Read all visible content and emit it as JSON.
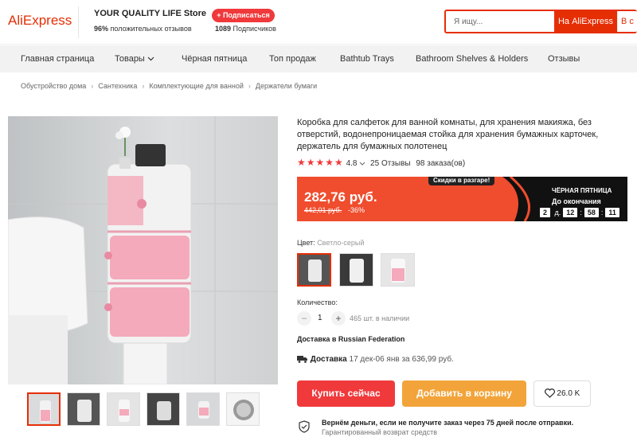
{
  "header": {
    "logo": "AliExpress",
    "store_name": "YOUR QUALITY LIFE Store",
    "caret": "›",
    "subscribe_label": "+ Подписаться",
    "positive_pct": "96%",
    "positive_label": "положительных отзывов",
    "subscribers_count": "1089",
    "subscribers_label": "Подписчиков",
    "search_placeholder": "Я ищу...",
    "search_button": "На AliExpress",
    "search_button2": "В с"
  },
  "nav": {
    "items": [
      "Главная страница",
      "Товары",
      "Чёрная пятница",
      "Топ продаж",
      "Bathtub Trays",
      "Bathroom Shelves & Holders",
      "Отзывы"
    ]
  },
  "breadcrumbs": [
    "Обустройство дома",
    "Сантехника",
    "Комплектующие для ванной",
    "Держатели бумаги"
  ],
  "product": {
    "title": "Коробка для салфеток для ванной комнаты, для хранения макияжа, без отверстий, водонепроницаемая стойка для хранения бумажных карточек, держатель для бумажных полотенец",
    "rating": "4.8",
    "reviews": "25 Отзывы",
    "orders": "98 заказа(ов)"
  },
  "promo": {
    "tag": "Скидки в разгаре!",
    "price": "282,76 руб.",
    "old_price": "442,01 руб.",
    "discount": "-36%",
    "black_friday": "ЧЁРНАЯ ПЯТНИЦА",
    "until_label": "До окончания",
    "days": "2",
    "days_unit": "д.",
    "hours": "12",
    "minutes": "58",
    "seconds": "11",
    "accent_color": "#ef4d2e"
  },
  "options": {
    "color_label": "Цвет:",
    "color_value": "Светло-серый",
    "quantity_label": "Количество:",
    "quantity": "1",
    "minus": "−",
    "plus": "+",
    "stock": "465 шт. в наличии"
  },
  "delivery": {
    "to": "Доставка в Russian Federation",
    "label": "Доставка",
    "details": "17 дек-06 янв за 636,99 руб."
  },
  "actions": {
    "buy": "Купить сейчас",
    "cart": "Добавить в корзину",
    "wishlist_count": "26.0 K"
  },
  "guarantee": {
    "line1": "Вернём деньги, если не получите заказ через 75 дней после отправки.",
    "line2": "Гарантированный возврат средств"
  }
}
